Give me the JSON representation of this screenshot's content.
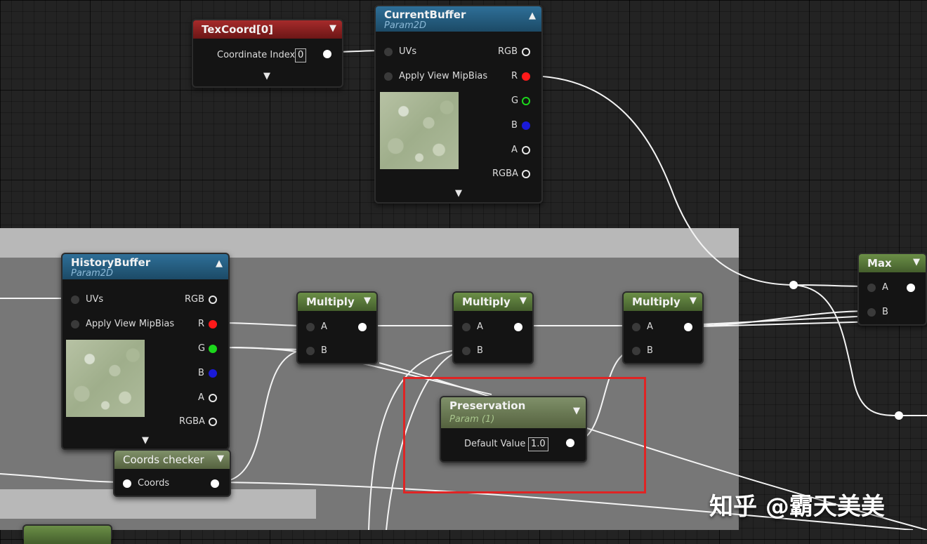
{
  "nodes": {
    "texcoord": {
      "title": "TexCoord[0]",
      "input_label": "Coordinate Index",
      "input_value": "0"
    },
    "current_buffer": {
      "title": "CurrentBuffer",
      "subtitle": "Param2D",
      "inputs": [
        "UVs",
        "Apply View MipBias"
      ],
      "outputs": [
        "RGB",
        "R",
        "G",
        "B",
        "A",
        "RGBA"
      ]
    },
    "history_buffer": {
      "title": "HistoryBuffer",
      "subtitle": "Param2D",
      "inputs": [
        "UVs",
        "Apply View MipBias"
      ],
      "outputs": [
        "RGB",
        "R",
        "G",
        "B",
        "A",
        "RGBA"
      ]
    },
    "multiply_1": {
      "title": "Multiply",
      "inputs": [
        "A",
        "B"
      ]
    },
    "multiply_2": {
      "title": "Multiply",
      "inputs": [
        "A",
        "B"
      ]
    },
    "multiply_3": {
      "title": "Multiply",
      "inputs": [
        "A",
        "B"
      ]
    },
    "max": {
      "title": "Max",
      "inputs": [
        "A",
        "B"
      ]
    },
    "preservation": {
      "title": "Preservation",
      "subtitle": "Param (1)",
      "input_label": "Default Value",
      "input_value": "1.0"
    },
    "coords_checker": {
      "title": "Coords checker",
      "input_label": "Coords"
    }
  },
  "watermark": "知乎 @霸天美美",
  "colors": {
    "selection_box": "#e02424",
    "pin_red": "#ff1a1a",
    "pin_green": "#1cd71c",
    "pin_blue": "#1a1ad8",
    "header_blue": "#2e6f98",
    "header_red": "#a62b2b",
    "header_green": "#6b8f47"
  },
  "icons": [
    "chevron-down-icon",
    "chevron-up-icon"
  ]
}
